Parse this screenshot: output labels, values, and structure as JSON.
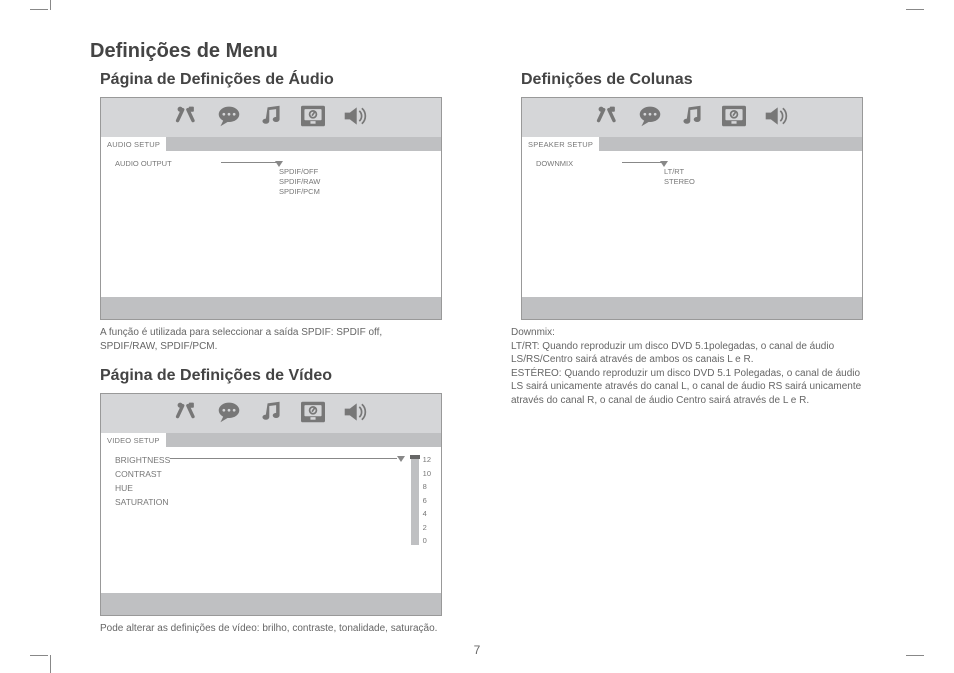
{
  "page_number": "7",
  "title": "Definições de Menu",
  "left": {
    "audio": {
      "heading": "Página de Definições de Áudio",
      "tab": "AUDIO SETUP",
      "item": "AUDIO OUTPUT",
      "options": [
        "SPDIF/OFF",
        "SPDIF/RAW",
        "SPDIF/PCM"
      ],
      "caption": "A função é utilizada para seleccionar a saída SPDIF: SPDIF off, SPDIF/RAW, SPDIF/PCM."
    },
    "video": {
      "heading": "Página de Definições de Vídeo",
      "tab": "VIDEO SETUP",
      "items": [
        "BRIGHTNESS",
        "CONTRAST",
        "HUE",
        "SATURATION"
      ],
      "ticks": [
        "12",
        "10",
        "8",
        "6",
        "4",
        "2",
        "0"
      ],
      "caption": "Pode alterar as definições de vídeo: brilho, contraste, tonalidade, saturação."
    }
  },
  "right": {
    "speaker": {
      "heading": "Definições de Colunas",
      "tab": "SPEAKER SETUP",
      "item": "DOWNMIX",
      "options": [
        "LT/RT",
        "STEREO"
      ],
      "caption": "Downmix:\nLT/RT: Quando reproduzir um disco DVD 5.1polegadas, o canal de áudio LS/RS/Centro sairá através de ambos os canais L e R.\nESTÉREO: Quando reproduzir um disco DVD 5.1 Polegadas, o canal de áudio LS sairá unicamente através do canal L, o canal de áudio RS sairá unicamente através do canal R, o canal de áudio Centro sairá através de L e R."
    }
  },
  "icons": [
    "tools",
    "speech",
    "music",
    "monitor",
    "speaker"
  ]
}
